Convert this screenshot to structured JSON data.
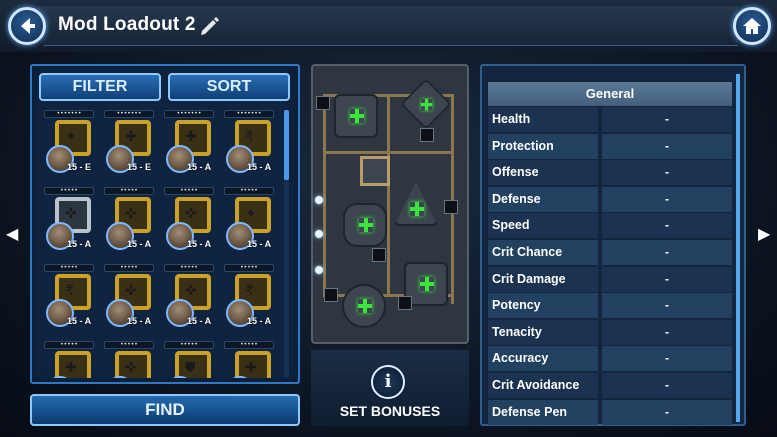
{
  "header": {
    "title": "Mod Loadout 2"
  },
  "toolbar": {
    "filter_label": "FILTER",
    "sort_label": "SORT",
    "find_label": "FIND"
  },
  "mods": [
    {
      "dots": "•••••••",
      "level": "15 - E",
      "frame": "gold",
      "glyph": "✦"
    },
    {
      "dots": "•••••••",
      "level": "15 - E",
      "frame": "gold",
      "glyph": "✚"
    },
    {
      "dots": "•••••••",
      "level": "15 - A",
      "frame": "gold",
      "glyph": "✚"
    },
    {
      "dots": "•••••••",
      "level": "15 - A",
      "frame": "gold",
      "glyph": "₹"
    },
    {
      "dots": "•••••",
      "level": "15 - A",
      "frame": "silver",
      "glyph": "✜"
    },
    {
      "dots": "•••••",
      "level": "15 - A",
      "frame": "gold",
      "glyph": "✜"
    },
    {
      "dots": "•••••",
      "level": "15 - A",
      "frame": "gold",
      "glyph": "✜"
    },
    {
      "dots": "•••••",
      "level": "15 - A",
      "frame": "gold",
      "glyph": "✦"
    },
    {
      "dots": "•••••",
      "level": "15 - A",
      "frame": "gold",
      "glyph": "₹"
    },
    {
      "dots": "•••••",
      "level": "15 - A",
      "frame": "gold",
      "glyph": "✜"
    },
    {
      "dots": "•••••",
      "level": "15 - A",
      "frame": "gold",
      "glyph": "✜"
    },
    {
      "dots": "•••••",
      "level": "15 - A",
      "frame": "gold",
      "glyph": "₹"
    },
    {
      "dots": "•••••",
      "level": "",
      "frame": "gold",
      "glyph": "✚"
    },
    {
      "dots": "•••••",
      "level": "",
      "frame": "gold",
      "glyph": "✜"
    },
    {
      "dots": "•••••",
      "level": "",
      "frame": "gold",
      "glyph": "⛊"
    },
    {
      "dots": "•••••",
      "level": "",
      "frame": "gold",
      "glyph": "✚"
    }
  ],
  "set_bonuses": {
    "label": "SET BONUSES",
    "icon": "i"
  },
  "stats": {
    "header": "General",
    "rows": [
      {
        "name": "Health",
        "value": "-"
      },
      {
        "name": "Protection",
        "value": "-"
      },
      {
        "name": "Offense",
        "value": "-"
      },
      {
        "name": "Defense",
        "value": "-"
      },
      {
        "name": "Speed",
        "value": "-"
      },
      {
        "name": "Crit Chance",
        "value": "-"
      },
      {
        "name": "Crit Damage",
        "value": "-"
      },
      {
        "name": "Potency",
        "value": "-"
      },
      {
        "name": "Tenacity",
        "value": "-"
      },
      {
        "name": "Accuracy",
        "value": "-"
      },
      {
        "name": "Crit Avoidance",
        "value": "-"
      },
      {
        "name": "Defense Pen",
        "value": "-"
      }
    ]
  },
  "colors": {
    "accent": "#2d79c7",
    "mod_gold": "#c9a227",
    "slot_plus": "#3be53b"
  }
}
